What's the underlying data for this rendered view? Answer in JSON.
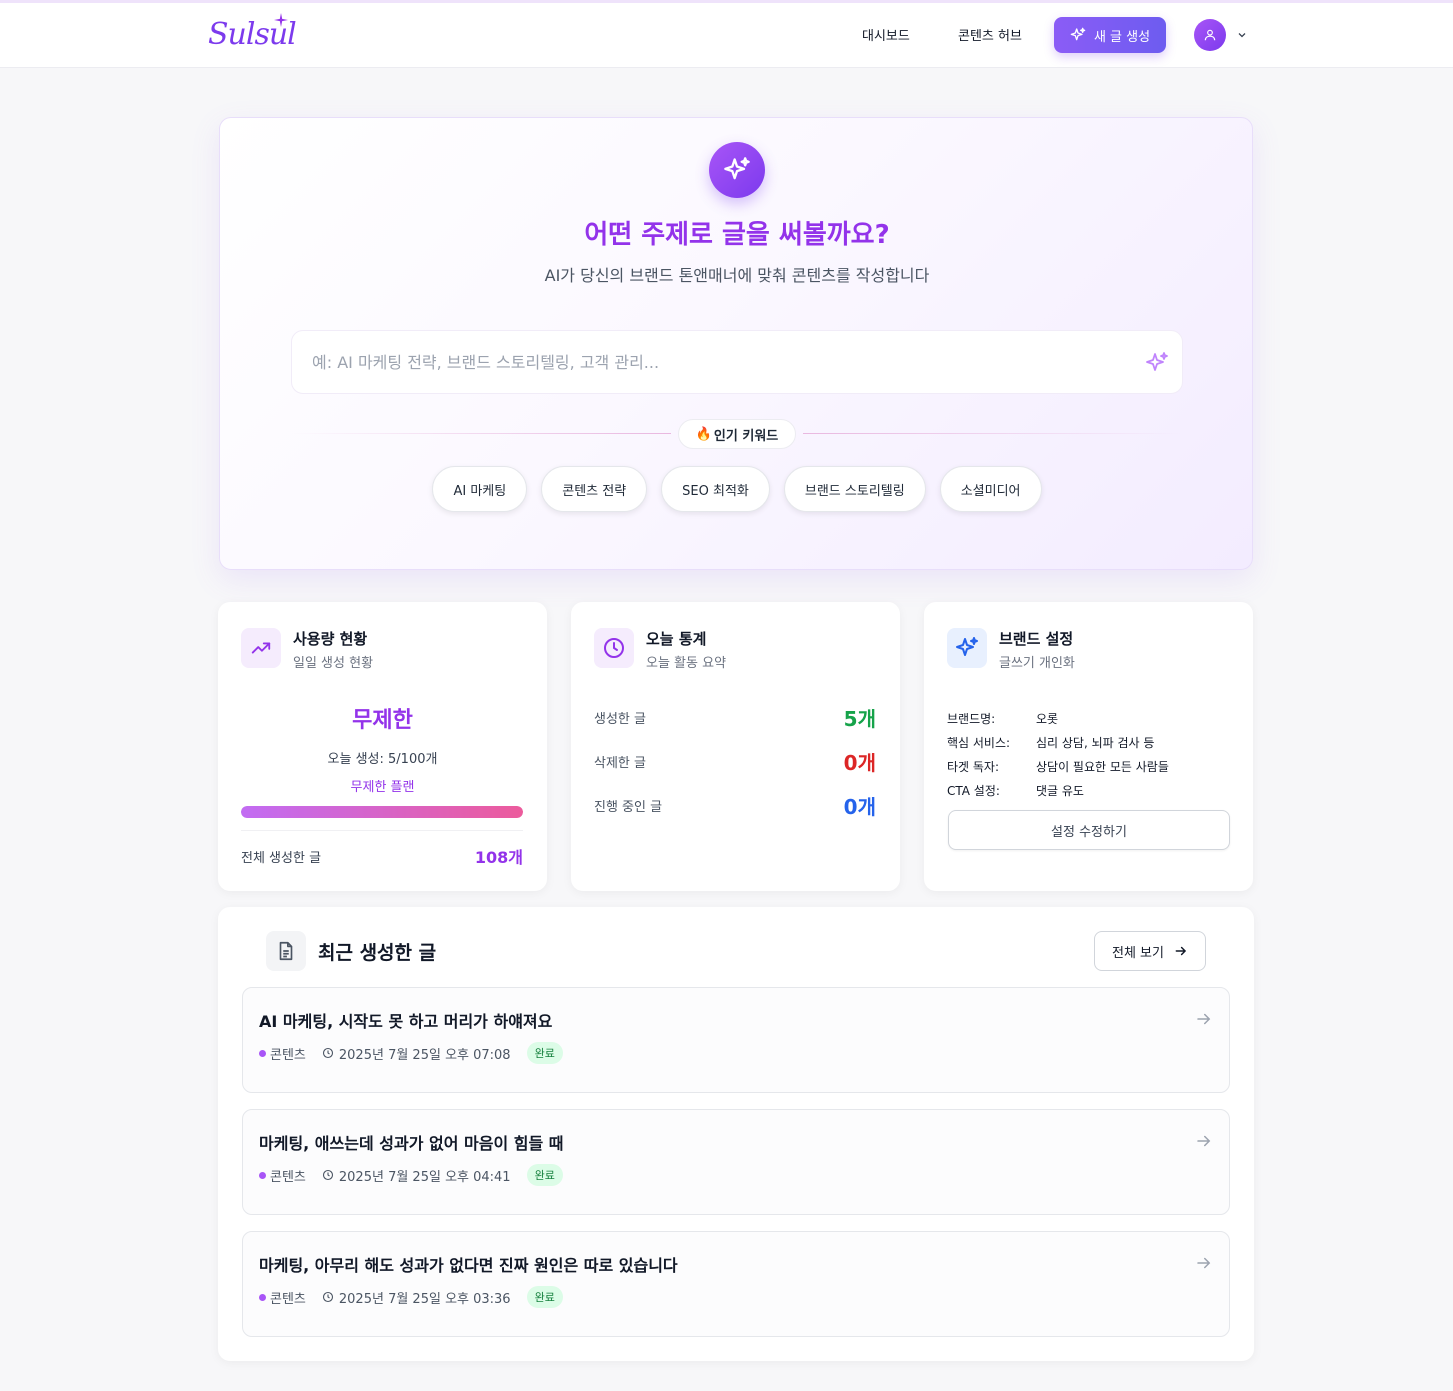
{
  "app": {
    "logo": "Sulsul"
  },
  "nav": {
    "dashboard": "대시보드",
    "content_hub": "콘텐츠 허브",
    "new_post": "새 글 생성"
  },
  "hero": {
    "title": "어떤 주제로 글을 써볼까요?",
    "subtitle": "AI가 당신의 브랜드 톤앤매너에 맞춰 콘텐츠를 작성합니다",
    "search_placeholder": "예: AI 마케팅 전략, 브랜드 스토리텔링, 고객 관리...",
    "search_value": "",
    "popular_emoji": "🔥",
    "popular_label": "인기 키워드",
    "keywords": [
      "AI 마케팅",
      "콘텐츠 전략",
      "SEO 최적화",
      "브랜드 스토리텔링",
      "소셜미디어"
    ]
  },
  "usage": {
    "title": "사용량 현황",
    "subtitle": "일일 생성 현황",
    "status": "무제한",
    "today": "오늘 생성: 5/100개",
    "plan": "무제한 플랜",
    "progress_percent": 100,
    "total_label": "전체 생성한 글",
    "total_value": "108개"
  },
  "today_stats": {
    "title": "오늘 통계",
    "subtitle": "오늘 활동 요약",
    "rows": [
      {
        "label": "생성한 글",
        "value": "5개",
        "color": "#16a34a"
      },
      {
        "label": "삭제한 글",
        "value": "0개",
        "color": "#dc2626"
      },
      {
        "label": "진행 중인 글",
        "value": "0개",
        "color": "#2563eb"
      }
    ]
  },
  "brand": {
    "title": "브랜드 설정",
    "subtitle": "글쓰기 개인화",
    "rows": [
      {
        "key": "브랜드명:",
        "value": "오롯"
      },
      {
        "key": "핵심 서비스:",
        "value": "심리 상담, 뇌파 검사 등"
      },
      {
        "key": "타겟 독자:",
        "value": "상담이 필요한 모든 사람들"
      },
      {
        "key": "CTA 설정:",
        "value": "댓글 유도"
      }
    ],
    "edit_label": "설정 수정하기"
  },
  "recent": {
    "title": "최근 생성한 글",
    "view_all": "전체 보기",
    "posts": [
      {
        "title": "AI 마케팅, 시작도 못 하고 머리가 하얘져요",
        "category": "콘텐츠",
        "date": "2025년 7월 25일 오후 07:08",
        "status": "완료"
      },
      {
        "title": "마케팅, 애쓰는데 성과가 없어 마음이 힘들 때",
        "category": "콘텐츠",
        "date": "2025년 7월 25일 오후 04:41",
        "status": "완료"
      },
      {
        "title": "마케팅, 아무리 해도 성과가 없다면 진짜 원인은 따로 있습니다",
        "category": "콘텐츠",
        "date": "2025년 7월 25일 오후 03:36",
        "status": "완료"
      }
    ]
  },
  "colors": {
    "brand": "#9333ea",
    "accent": "#8b5cf6",
    "success": "#16a34a",
    "danger": "#dc2626",
    "info": "#2563eb"
  },
  "icons": [
    "sparkle-icon",
    "user-icon",
    "chevron-down-icon",
    "trending-up-icon",
    "clock-icon",
    "document-icon",
    "arrow-right-icon",
    "fire-icon"
  ]
}
